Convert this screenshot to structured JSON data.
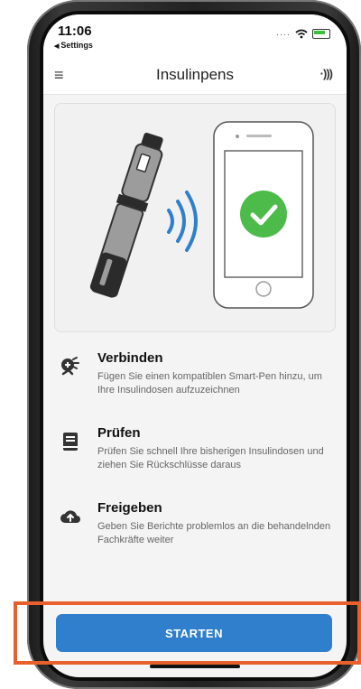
{
  "status_bar": {
    "time": "11:06",
    "back_label": "Settings"
  },
  "header": {
    "title": "Insulinpens",
    "menu_icon": "menu-icon",
    "nfc_icon": "nfc-icon"
  },
  "illustration": {
    "pen_icon": "insulin-pen",
    "wave_icon": "signal-wave-icon",
    "phone_icon": "smartphone",
    "check_color": "#4cbb4a",
    "wave_color": "#2f7fcc"
  },
  "features": [
    {
      "icon": "connect-icon",
      "title": "Verbinden",
      "desc": "Fügen Sie einen kompatiblen Smart-Pen hinzu, um Ihre Insulindosen aufzuzeichnen"
    },
    {
      "icon": "book-icon",
      "title": "Prüfen",
      "desc": "Prüfen Sie schnell Ihre bisherigen Insulindosen und ziehen Sie Rückschlüsse daraus"
    },
    {
      "icon": "cloud-upload-icon",
      "title": "Freigeben",
      "desc": "Geben Sie Berichte problemlos an die behandelnden Fachkräfte weiter"
    }
  ],
  "start_button": {
    "label": "STARTEN",
    "color": "#2f7fcc"
  },
  "highlight_color": "#e8602c"
}
